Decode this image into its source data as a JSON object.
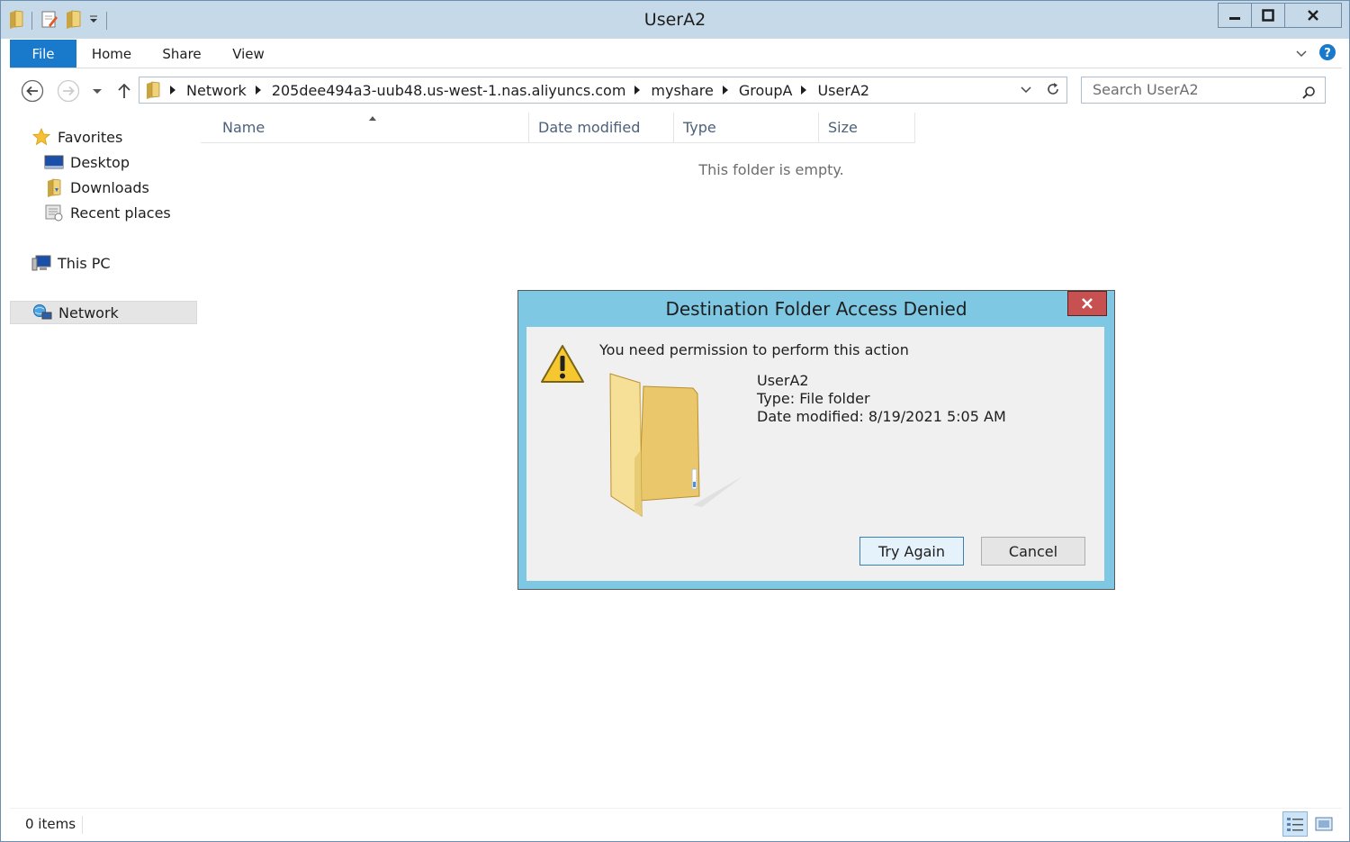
{
  "window": {
    "title": "UserA2"
  },
  "ribbon": {
    "tabs": [
      "File",
      "Home",
      "Share",
      "View"
    ]
  },
  "address": {
    "segments": [
      "Network",
      "205dee494a3-uub48.us-west-1.nas.aliyuncs.com",
      "myshare",
      "GroupA",
      "UserA2"
    ]
  },
  "search": {
    "placeholder": "Search UserA2"
  },
  "nav": {
    "favorites": "Favorites",
    "desktop": "Desktop",
    "downloads": "Downloads",
    "recent": "Recent places",
    "this_pc": "This PC",
    "network": "Network"
  },
  "columns": {
    "name": "Name",
    "date": "Date modified",
    "type": "Type",
    "size": "Size"
  },
  "content": {
    "empty": "This folder is empty."
  },
  "status": {
    "items": "0 items"
  },
  "dialog": {
    "title": "Destination Folder Access Denied",
    "message": "You need permission to perform this action",
    "item_name": "UserA2",
    "item_type": "Type: File folder",
    "item_date": "Date modified: 8/19/2021 5:05 AM",
    "try_again": "Try Again",
    "cancel": "Cancel"
  }
}
